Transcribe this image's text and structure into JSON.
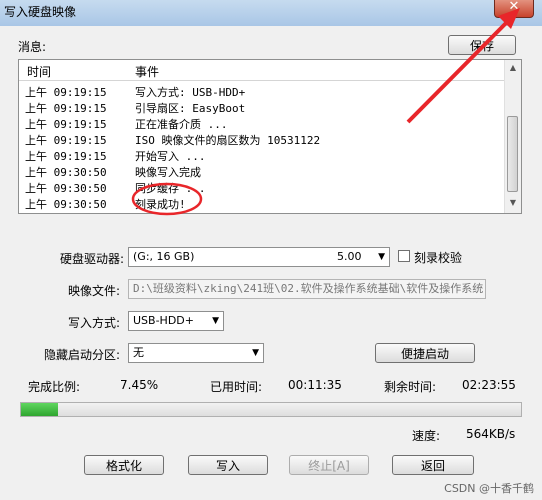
{
  "window": {
    "title": "写入硬盘映像",
    "close_glyph": "✕"
  },
  "messages": {
    "label": "消息:",
    "save_label": "保存",
    "columns": {
      "time": "时间",
      "event": "事件"
    },
    "rows": [
      {
        "time": "上午 09:19:15",
        "event": "写入方式: USB-HDD+"
      },
      {
        "time": "上午 09:19:15",
        "event": "引导扇区: EasyBoot"
      },
      {
        "time": "上午 09:19:15",
        "event": "正在准备介质 ..."
      },
      {
        "time": "上午 09:19:15",
        "event": "ISO 映像文件的扇区数为 10531122"
      },
      {
        "time": "上午 09:19:15",
        "event": "开始写入 ..."
      },
      {
        "time": "上午 09:30:50",
        "event": "映像写入完成"
      },
      {
        "time": "上午 09:30:50",
        "event": "同步缓存 ..."
      },
      {
        "time": "上午 09:30:50",
        "event": "刻录成功!"
      }
    ]
  },
  "drive": {
    "label": "硬盘驱动器:",
    "value": "(G:, 16 GB)",
    "size": "5.00",
    "verify_label": "刻录校验"
  },
  "image": {
    "label": "映像文件:",
    "value": "D:\\班级资料\\zking\\241班\\02.软件及操作系统基础\\软件及操作系统"
  },
  "write_mode": {
    "label": "写入方式:",
    "value": "USB-HDD+"
  },
  "hidden_partition": {
    "label": "隐藏启动分区:",
    "value": "无"
  },
  "quick_boot": {
    "label": "便捷启动"
  },
  "status": {
    "progress_label": "完成比例:",
    "progress_value": "7.45%",
    "elapsed_label": "已用时间:",
    "elapsed_value": "00:11:35",
    "remaining_label": "剩余时间:",
    "remaining_value": "02:23:55",
    "speed_label": "速度:",
    "speed_value": "564KB/s",
    "progress_fraction": 0.0745
  },
  "buttons": {
    "format": "格式化",
    "write": "写入",
    "stop": "终止[A]",
    "back": "返回"
  },
  "watermark": "CSDN @十香千鹤",
  "annotation_colors": {
    "red": "#e8262a"
  }
}
